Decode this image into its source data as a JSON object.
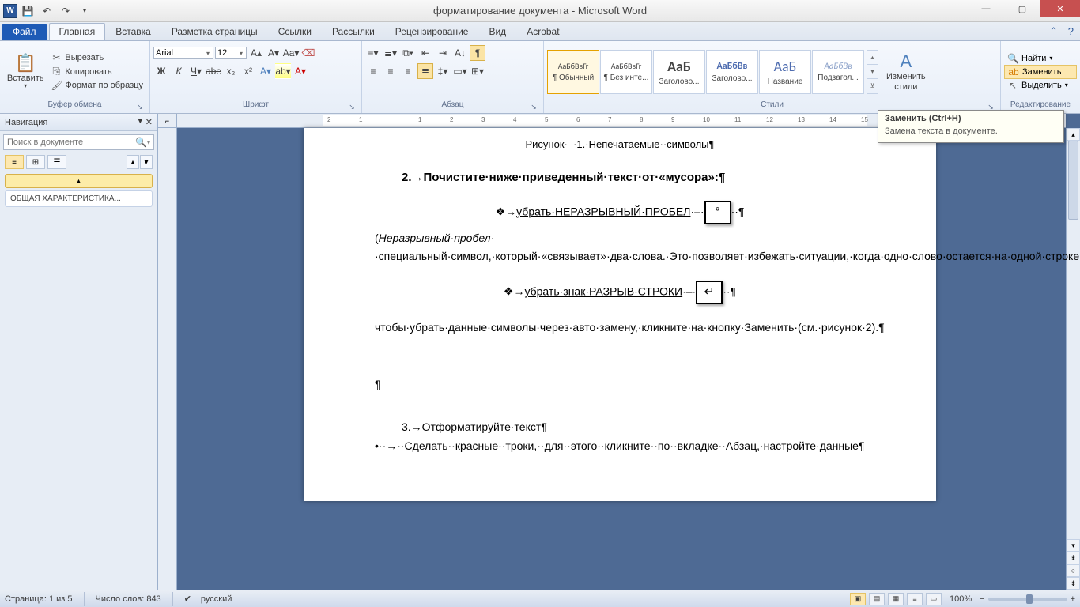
{
  "title": "форматирование документа - Microsoft Word",
  "qat": {
    "word": "W"
  },
  "tabs": {
    "file": "Файл",
    "items": [
      "Главная",
      "Вставка",
      "Разметка страницы",
      "Ссылки",
      "Рассылки",
      "Рецензирование",
      "Вид",
      "Acrobat"
    ],
    "active": 0
  },
  "ribbon": {
    "clipboard": {
      "label": "Буфер обмена",
      "paste": "Вставить",
      "cut": "Вырезать",
      "copy": "Копировать",
      "format_painter": "Формат по образцу"
    },
    "font": {
      "label": "Шрифт",
      "name": "Arial",
      "size": "12"
    },
    "paragraph": {
      "label": "Абзац"
    },
    "styles": {
      "label": "Стили",
      "items": [
        {
          "preview": "АаБбВвГг",
          "name": "¶ Обычный",
          "selected": true
        },
        {
          "preview": "АаБбВвГг",
          "name": "¶ Без инте...",
          "selected": false
        },
        {
          "preview": "АаБ",
          "name": "Заголово...",
          "selected": false,
          "big": true,
          "color": "#000"
        },
        {
          "preview": "АаБбВв",
          "name": "Заголово...",
          "selected": false,
          "color": "#4f6db0"
        },
        {
          "preview": "АаБ",
          "name": "Название",
          "selected": false,
          "big": true,
          "color": "#4f6db0"
        },
        {
          "preview": "АаБбВв",
          "name": "Подзагол...",
          "selected": false,
          "italic": true,
          "color": "#8aa0c8"
        }
      ],
      "change_styles": "Изменить\nстили"
    },
    "editing": {
      "label": "Редактирование",
      "find": "Найти",
      "replace": "Заменить",
      "select": "Выделить"
    }
  },
  "tooltip": {
    "title": "Заменить (Ctrl+H)",
    "body": "Замена текста в документе."
  },
  "nav": {
    "title": "Навигация",
    "search_placeholder": "Поиск в документе",
    "item1": "ОБЩАЯ ХАРАКТЕРИСТИКА..."
  },
  "doc": {
    "caption": "Рисунок·–·1.·Непечатаемые··символы¶",
    "heading": "2.→Почистите·ниже·приведенный·текст·от·«мусора»:¶",
    "bullet1_pre": "❖→",
    "bullet1_u": "убрать·НЕРАЗРЫВНЫЙ·ПРОБЕЛ",
    "bullet1_post": "·–·",
    "bullet1_tail": "··¶",
    "para1": "(Неразрывный·пробел·—·специальный·символ,·который·«связывает»·два·слова.·Это·позволяет·избежать·ситуации,·когда·одно·слово·остается·на·одной·строке,·а·второе·переносится·на·следующую);¶",
    "bullet2_pre": "❖→",
    "bullet2_u": "убрать·знак·РАЗРЫВ·СТРОКИ",
    "bullet2_post": "·–·",
    "bullet2_tail": "··¶",
    "para2": "чтобы·убрать·данные·символы·через·авто·замену,·кликните·на·кнопку·Заменить·(см.·рисунок·2).¶",
    "pmark": "¶",
    "heading3": "3.→Отформатируйте·текст¶",
    "bullet3": "•··→··Сделать··красные··троки,··для··этого··кликните··по··вкладке··Абзац,·настройте·данные¶",
    "img1_glyph": "°",
    "img2_glyph": "↵"
  },
  "status": {
    "page": "Страница: 1 из 5",
    "words": "Число слов: 843",
    "lang": "русский",
    "zoom": "100%"
  }
}
